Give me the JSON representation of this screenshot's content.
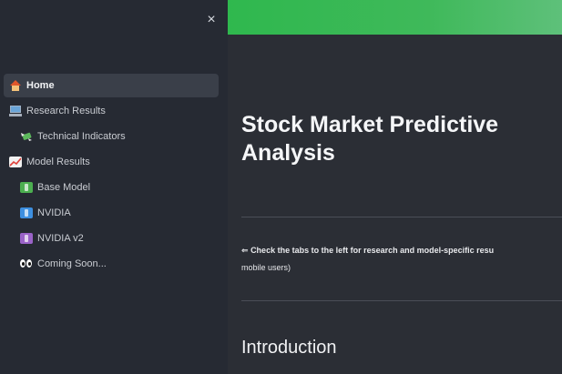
{
  "sidebar": {
    "close_symbol": "×",
    "items": [
      {
        "label": "Home",
        "icon": "house-icon",
        "active": true
      },
      {
        "label": "Research Results",
        "icon": "laptop-icon"
      },
      {
        "label": "Technical Indicators",
        "icon": "money-with-wings-icon"
      },
      {
        "label": "Model Results",
        "icon": "chart-increasing-icon"
      },
      {
        "label": "Base Model",
        "icon": "cash-icon"
      },
      {
        "label": "NVIDIA",
        "icon": "cash-icon"
      },
      {
        "label": "NVIDIA v2",
        "icon": "cash-icon"
      },
      {
        "label": "Coming Soon...",
        "icon": "eyes-icon"
      }
    ]
  },
  "header": {
    "gradient_colors": [
      "#2fb84e",
      "#5ec07a"
    ]
  },
  "main": {
    "title": "Stock Market Predictive Analysis",
    "info_arrow": "⇐",
    "info_line1": "Check the tabs to the left for research and model-specific resu",
    "info_line2": "mobile users)",
    "subheading": "Introduction"
  },
  "colors": {
    "sidebar_bg": "#262a33",
    "main_bg": "#2b2e35",
    "active_item_bg": "#3a3f49",
    "accent_green": "#2fb84e"
  }
}
